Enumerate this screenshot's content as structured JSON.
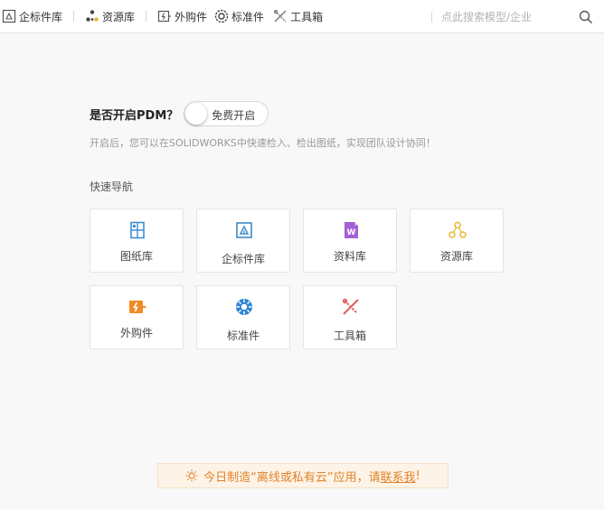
{
  "toolbar": {
    "items": [
      {
        "label": "企标件库",
        "icon": "enterprise-parts-icon"
      },
      {
        "label": "资源库",
        "icon": "resource-library-icon"
      },
      {
        "label": "外购件",
        "icon": "purchased-parts-icon"
      },
      {
        "label": "标准件",
        "icon": "standard-parts-icon"
      },
      {
        "label": "工具箱",
        "icon": "toolbox-icon"
      }
    ],
    "search_placeholder": "点此搜索模型/企业",
    "search_icon": "search-icon"
  },
  "pdm": {
    "title": "是否开启PDM？",
    "toggle_label": "免费开启",
    "toggle_on": false,
    "description": "开启后，您可以在SOLIDWORKS中快速检入、检出图纸，实现团队设计协同！"
  },
  "quick_nav": {
    "title": "快速导航",
    "cards": [
      {
        "label": "图纸库",
        "icon": "drawing-library-icon",
        "color": "#3d8fd6"
      },
      {
        "label": "企标件库",
        "icon": "enterprise-parts-icon",
        "color": "#3f8ac8"
      },
      {
        "label": "资料库",
        "icon": "document-library-icon",
        "color": "#a55ed6"
      },
      {
        "label": "资源库",
        "icon": "resource-library-icon",
        "color": "#e8b531"
      },
      {
        "label": "外购件",
        "icon": "purchased-parts-icon",
        "color": "#f08a26"
      },
      {
        "label": "标准件",
        "icon": "standard-parts-icon",
        "color": "#2f86d1"
      },
      {
        "label": "工具箱",
        "icon": "toolbox-icon",
        "color": "#e05a5a"
      }
    ]
  },
  "promo": {
    "text": "今日制造“离线或私有云”应用，请",
    "link": "联系我",
    "suffix": "!",
    "color": "#e2822a"
  }
}
